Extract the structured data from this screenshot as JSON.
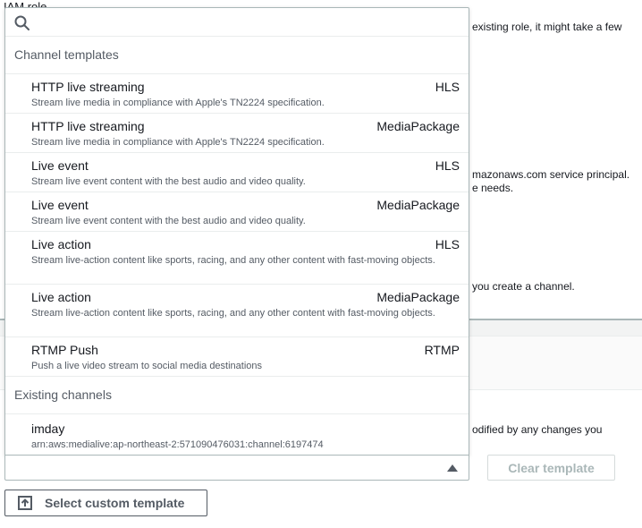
{
  "background": {
    "top_text": "IAM role",
    "line1": "existing role, it might take a few",
    "line2a": "mazonaws.com service principal.",
    "line2b": "e needs.",
    "line3": "you create a channel.",
    "line4": "odified by any changes you"
  },
  "dropdown": {
    "search": {
      "value": "",
      "placeholder": ""
    },
    "groups": [
      {
        "header": "Channel templates",
        "options": [
          {
            "label": "HTTP live streaming",
            "tag": "HLS",
            "description": "Stream live media in compliance with Apple's TN2224 specification."
          },
          {
            "label": "HTTP live streaming",
            "tag": "MediaPackage",
            "description": "Stream live media in compliance with Apple's TN2224 specification."
          },
          {
            "label": "Live event",
            "tag": "HLS",
            "description": "Stream live event content with the best audio and video quality."
          },
          {
            "label": "Live event",
            "tag": "MediaPackage",
            "description": "Stream live event content with the best audio and video quality."
          },
          {
            "label": "Live action",
            "tag": "HLS",
            "description": "Stream live-action content like sports, racing, and any other content with fast-moving objects."
          },
          {
            "label": "Live action",
            "tag": "MediaPackage",
            "description": "Stream live-action content like sports, racing, and any other content with fast-moving objects."
          },
          {
            "label": "RTMP Push",
            "tag": "RTMP",
            "description": "Push a live video stream to social media destinations"
          }
        ]
      },
      {
        "header": "Existing channels",
        "options": [
          {
            "label": "imday",
            "tag": "",
            "description": "arn:aws:medialive:ap-northeast-2:571090476031:channel:6197474"
          }
        ]
      }
    ]
  },
  "template_select": {
    "value": ""
  },
  "buttons": {
    "clear_template": "Clear template",
    "select_custom_template": "Select custom template"
  },
  "colors": {
    "border": "#aab7b8",
    "text": "#16191f",
    "secondary_text": "#545b64",
    "disabled": "#aab7b8"
  }
}
